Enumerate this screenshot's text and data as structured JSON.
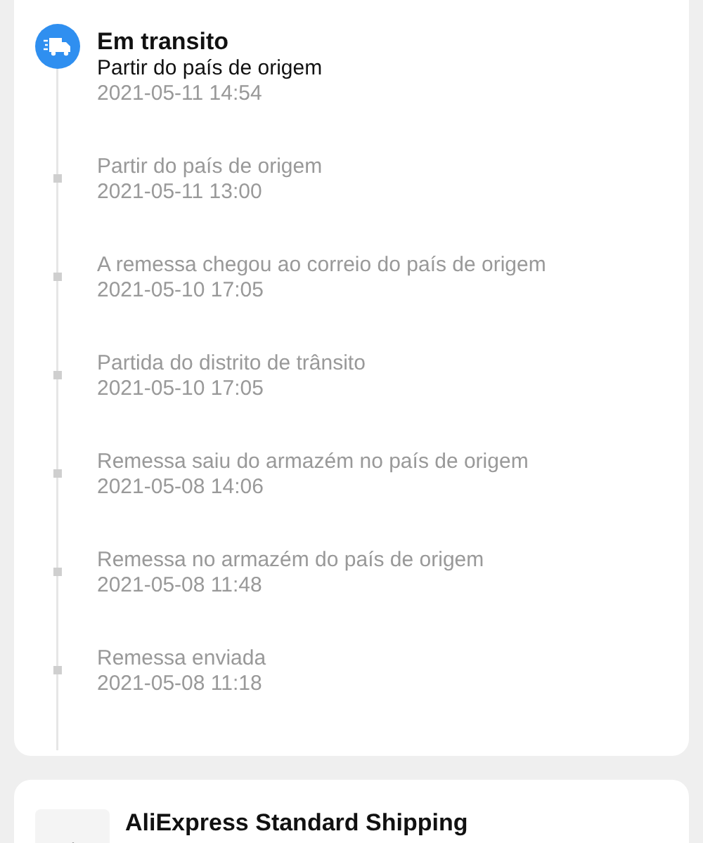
{
  "tracking": {
    "events": [
      {
        "kind": "current",
        "status": "Em transito",
        "description": "Partir do país de origem",
        "time": "2021-05-11 14:54"
      },
      {
        "kind": "past",
        "description": "Partir do país de origem",
        "time": "2021-05-11 13:00"
      },
      {
        "kind": "past",
        "description": "A remessa chegou ao correio do país de origem",
        "time": "2021-05-10 17:05"
      },
      {
        "kind": "past",
        "description": "Partida do  distrito de trânsito",
        "time": "2021-05-10 17:05"
      },
      {
        "kind": "past",
        "description": "Remessa saiu do armazém no país de origem",
        "time": "2021-05-08 14:06"
      },
      {
        "kind": "past",
        "description": "Remessa no armazém do país de origem",
        "time": "2021-05-08 11:48"
      },
      {
        "kind": "past",
        "description": "Remessa enviada",
        "time": "2021-05-08 11:18"
      }
    ]
  },
  "shipping": {
    "service": "AliExpress Standard Shipping"
  }
}
